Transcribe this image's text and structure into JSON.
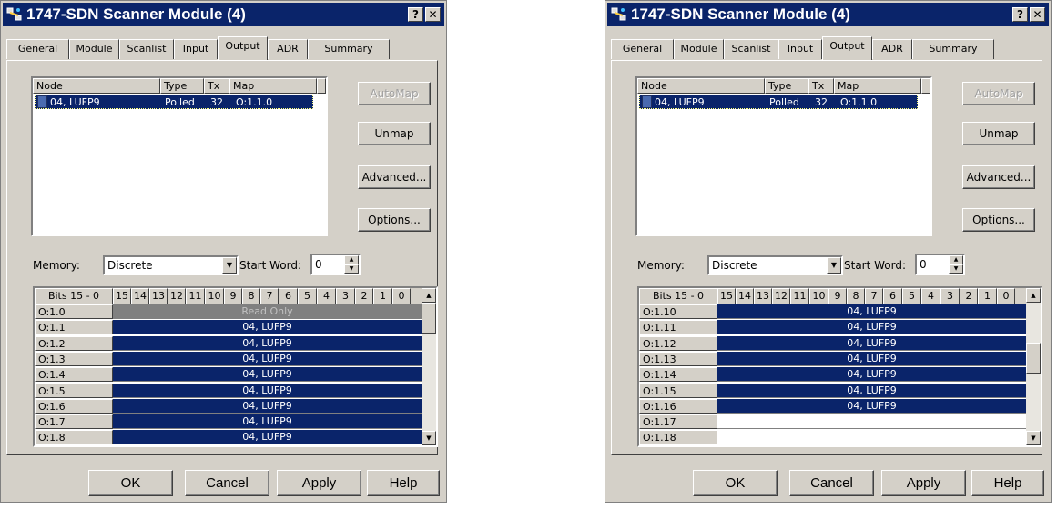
{
  "dialogs": [
    {
      "title": "1747-SDN Scanner Module (4)",
      "titlebar_buttons": {
        "help": "?",
        "close": "✕"
      },
      "tabs": [
        "General",
        "Module",
        "Scanlist",
        "Input",
        "Output",
        "ADR",
        "Summary"
      ],
      "active_tab": "Output",
      "scanlist": {
        "columns": [
          "Node",
          "Type",
          "Tx",
          "Map"
        ],
        "rows": [
          {
            "node": "04, LUFP9",
            "type": "Polled",
            "tx": "32",
            "map": "O:1.1.0"
          }
        ]
      },
      "buttons": {
        "automap": "AutoMap",
        "unmap": "Unmap",
        "advanced": "Advanced...",
        "options": "Options..."
      },
      "memory": {
        "label": "Memory:",
        "value": "Discrete"
      },
      "start_word": {
        "label": "Start Word:",
        "value": "0"
      },
      "bits_header": "Bits 15 - 0",
      "bit_columns": [
        "15",
        "14",
        "13",
        "12",
        "11",
        "10",
        "9",
        "8",
        "7",
        "6",
        "5",
        "4",
        "3",
        "2",
        "1",
        "0"
      ],
      "grid_rows": [
        {
          "addr": "O:1.0",
          "value": "Read Only",
          "state": "ro"
        },
        {
          "addr": "O:1.1",
          "value": "04, LUFP9",
          "state": "mapped"
        },
        {
          "addr": "O:1.2",
          "value": "04, LUFP9",
          "state": "mapped"
        },
        {
          "addr": "O:1.3",
          "value": "04, LUFP9",
          "state": "mapped"
        },
        {
          "addr": "O:1.4",
          "value": "04, LUFP9",
          "state": "mapped"
        },
        {
          "addr": "O:1.5",
          "value": "04, LUFP9",
          "state": "mapped"
        },
        {
          "addr": "O:1.6",
          "value": "04, LUFP9",
          "state": "mapped"
        },
        {
          "addr": "O:1.7",
          "value": "04, LUFP9",
          "state": "mapped"
        },
        {
          "addr": "O:1.8",
          "value": "04, LUFP9",
          "state": "mapped"
        }
      ],
      "bottom_buttons": {
        "ok": "OK",
        "cancel": "Cancel",
        "apply": "Apply",
        "help": "Help"
      }
    },
    {
      "title": "1747-SDN Scanner Module (4)",
      "titlebar_buttons": {
        "help": "?",
        "close": "✕"
      },
      "tabs": [
        "General",
        "Module",
        "Scanlist",
        "Input",
        "Output",
        "ADR",
        "Summary"
      ],
      "active_tab": "Output",
      "scanlist": {
        "columns": [
          "Node",
          "Type",
          "Tx",
          "Map"
        ],
        "rows": [
          {
            "node": "04, LUFP9",
            "type": "Polled",
            "tx": "32",
            "map": "O:1.1.0"
          }
        ]
      },
      "buttons": {
        "automap": "AutoMap",
        "unmap": "Unmap",
        "advanced": "Advanced...",
        "options": "Options..."
      },
      "memory": {
        "label": "Memory:",
        "value": "Discrete"
      },
      "start_word": {
        "label": "Start Word:",
        "value": "0"
      },
      "bits_header": "Bits 15 - 0",
      "bit_columns": [
        "15",
        "14",
        "13",
        "12",
        "11",
        "10",
        "9",
        "8",
        "7",
        "6",
        "5",
        "4",
        "3",
        "2",
        "1",
        "0"
      ],
      "grid_rows": [
        {
          "addr": "O:1.10",
          "value": "04, LUFP9",
          "state": "mapped"
        },
        {
          "addr": "O:1.11",
          "value": "04, LUFP9",
          "state": "mapped"
        },
        {
          "addr": "O:1.12",
          "value": "04, LUFP9",
          "state": "mapped"
        },
        {
          "addr": "O:1.13",
          "value": "04, LUFP9",
          "state": "mapped"
        },
        {
          "addr": "O:1.14",
          "value": "04, LUFP9",
          "state": "mapped"
        },
        {
          "addr": "O:1.15",
          "value": "04, LUFP9",
          "state": "mapped"
        },
        {
          "addr": "O:1.16",
          "value": "04, LUFP9",
          "state": "mapped"
        },
        {
          "addr": "O:1.17",
          "value": "",
          "state": "empty"
        },
        {
          "addr": "O:1.18",
          "value": "",
          "state": "empty"
        }
      ],
      "bottom_buttons": {
        "ok": "OK",
        "cancel": "Cancel",
        "apply": "Apply",
        "help": "Help"
      }
    }
  ],
  "colors": {
    "dialog_face": "#d4d0c8",
    "titlebar": "#0a246a",
    "selection": "#0a246a",
    "read_only": "#808080"
  }
}
